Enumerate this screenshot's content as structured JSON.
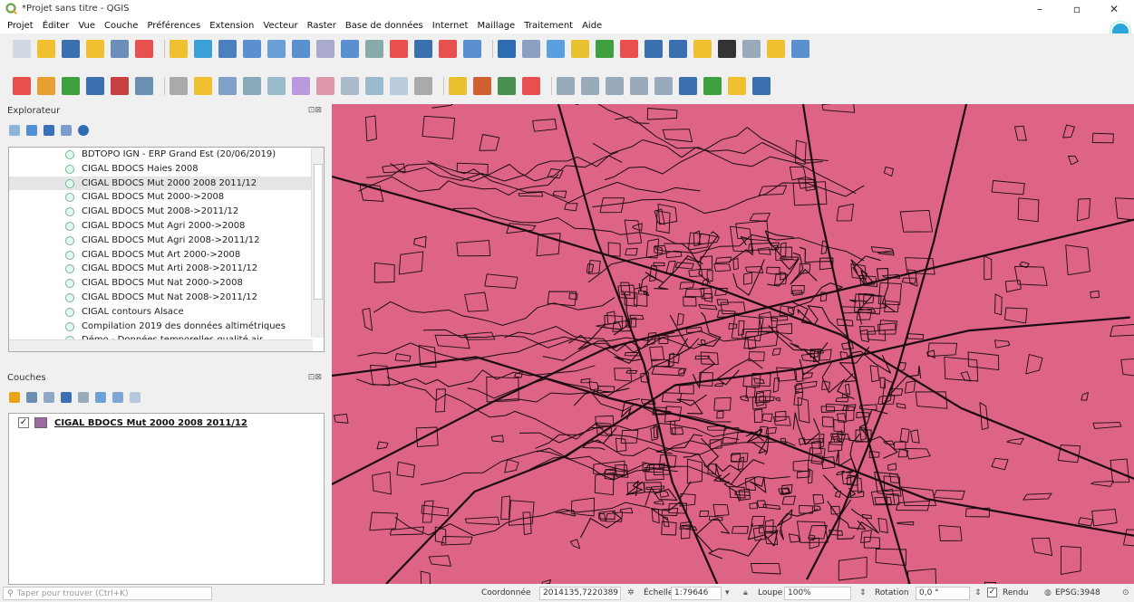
{
  "window": {
    "title": "*Projet sans titre - QGIS",
    "controls": {
      "minimize": "–",
      "maximize": "▫",
      "close": "✕"
    }
  },
  "menubar": {
    "items": [
      "Projet",
      "Éditer",
      "Vue",
      "Couche",
      "Préférences",
      "Extension",
      "Vecteur",
      "Raster",
      "Base de données",
      "Internet",
      "Maillage",
      "Traitement",
      "Aide"
    ]
  },
  "explorer": {
    "title": "Explorateur",
    "items": [
      {
        "label": "BDTOPO IGN - ERP Grand Est (20/06/2019)",
        "selected": false
      },
      {
        "label": "CIGAL BDOCS Haies 2008",
        "selected": false
      },
      {
        "label": "CIGAL BDOCS Mut 2000 2008 2011/12",
        "selected": true
      },
      {
        "label": "CIGAL BDOCS Mut 2000->2008",
        "selected": false
      },
      {
        "label": "CIGAL BDOCS Mut 2008->2011/12",
        "selected": false
      },
      {
        "label": "CIGAL BDOCS Mut Agri 2000->2008",
        "selected": false
      },
      {
        "label": "CIGAL BDOCS Mut Agri 2008->2011/12",
        "selected": false
      },
      {
        "label": "CIGAL BDOCS Mut Art 2000->2008",
        "selected": false
      },
      {
        "label": "CIGAL BDOCS Mut Arti 2008->2011/12",
        "selected": false
      },
      {
        "label": "CIGAL BDOCS Mut Nat 2000->2008",
        "selected": false
      },
      {
        "label": "CIGAL BDOCS Mut Nat 2008->2011/12",
        "selected": false
      },
      {
        "label": "CIGAL contours Alsace",
        "selected": false
      },
      {
        "label": "Compilation 2019 des données altimétriques",
        "selected": false
      },
      {
        "label": "Démo - Données temporelles qualité air",
        "selected": false
      }
    ]
  },
  "layers": {
    "title": "Couches",
    "items": [
      {
        "name": "CIGAL BDOCS Mut 2000 2008 2011/12",
        "checked": true,
        "color": "#9c6aa0"
      }
    ]
  },
  "map": {
    "fill_color": "#dd6485",
    "line_color": "#1a0c12"
  },
  "statusbar": {
    "search_placeholder": "Taper pour trouver (Ctrl+K)",
    "coord_label": "Coordonnée",
    "coord_value": "2014135,7220389",
    "scale_label": "Échelle",
    "scale_value": "1:79646",
    "magnifier_label": "Loupe",
    "magnifier_value": "100%",
    "rotation_label": "Rotation",
    "rotation_value": "0,0 °",
    "render_label": "Rendu",
    "crs_label": "EPSG:3948"
  }
}
